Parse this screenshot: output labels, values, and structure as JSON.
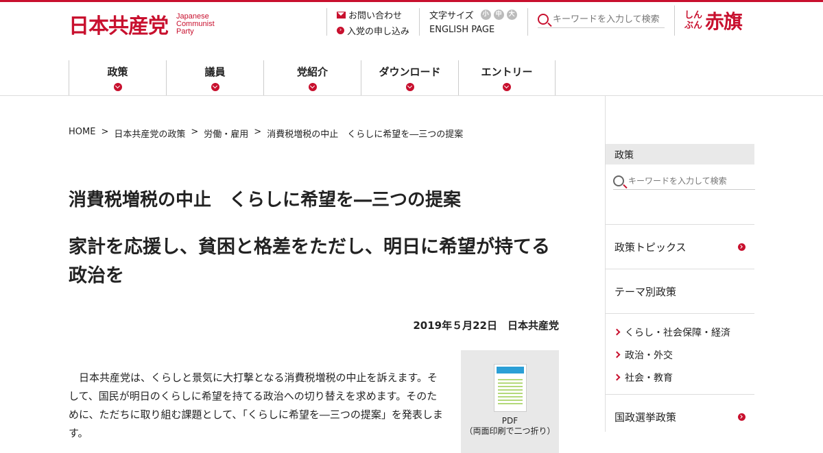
{
  "header": {
    "logo_jp": "日本共産党",
    "logo_en_1": "Japanese",
    "logo_en_2": "Communist",
    "logo_en_3": "Party",
    "contact_label": "お問い合わせ",
    "join_label": "入党の申し込み",
    "font_size_label": "文字サイズ",
    "font_small": "小",
    "font_medium": "中",
    "font_large": "大",
    "english_label": "ENGLISH PAGE",
    "search_placeholder": "キーワードを入力して検索",
    "akahata_small_1": "しん",
    "akahata_small_2": "ぶん",
    "akahata_big": "赤旗"
  },
  "nav": {
    "items": [
      {
        "label": "政策"
      },
      {
        "label": "議員"
      },
      {
        "label": "党紹介"
      },
      {
        "label": "ダウンロード"
      },
      {
        "label": "エントリー"
      }
    ]
  },
  "breadcrumb": {
    "items": [
      "HOME",
      "日本共産党の政策",
      "労働・雇用",
      "消費税増税の中止　くらしに希望を―三つの提案"
    ],
    "separator": ">"
  },
  "article": {
    "title": "消費税増税の中止　くらしに希望を―三つの提案",
    "subtitle": "家計を応援し、貧困と格差をただし、明日に希望が持てる政治を",
    "date": "2019年５月22日　日本共産党",
    "pdf_label_1": "PDF",
    "pdf_label_2": "（両面印刷で二つ折り）",
    "body": "日本共産党は、くらしと景気に大打撃となる消費税増税の中止を訴えます。そして、国民が明日のくらしに希望を持てる政治への切り替えを求めます。そのために、ただちに取り組む課題として、「くらしに希望を―三つの提案」を発表します。"
  },
  "sidebar": {
    "head": "政策",
    "search_placeholder": "キーワードを入力して検索",
    "topics": [
      "政策トピックス",
      "テーマ別政策"
    ],
    "sub_items": [
      "くらし・社会保障・経済",
      "政治・外交",
      "社会・教育"
    ],
    "bottom_topic": "国政選挙政策"
  },
  "colors": {
    "accent": "#c8102e"
  }
}
